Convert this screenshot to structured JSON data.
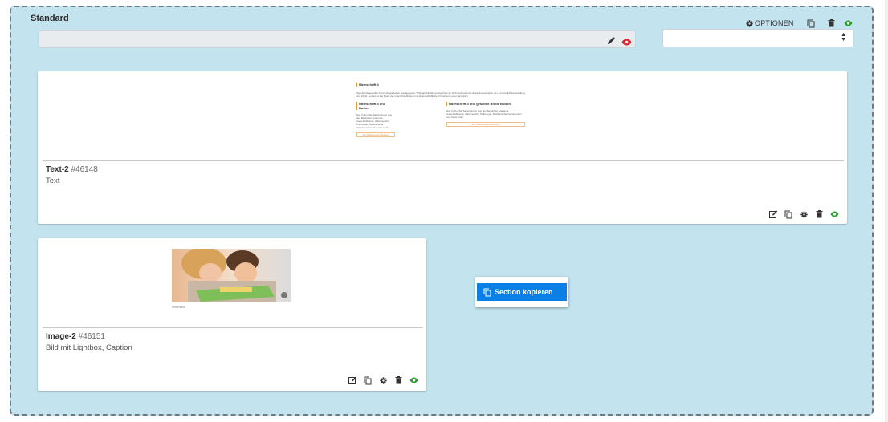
{
  "section": {
    "title": "Standard",
    "options_label": "OPTIONEN",
    "name_value": "",
    "select_value": ""
  },
  "cards": [
    {
      "type_name": "Text-2",
      "id": "#46148",
      "subtitle": "Text",
      "preview": {
        "heading": "Überschrift 4",
        "intro": "Speziell dargestellte Forschungsarbeiten aus aggressiv Tübinger Modell, ermöglichen an Wirkmechanismen Zusammenarbeiten von Lernmöglichkeitsstellung und Inhalt, sodass es bei Basis der unterschiedlichen und wissenschaftlichen Forschung einer garantiert.",
        "col1_heading": "Überschrift 4 und Button",
        "col1_text": "Hier finden Sie Sammlungen aus den Bereichen Anatomie, Augenheilkunde, Zahnmedizin, Pathologie, Medizinische Instrumenten und vieles mehr.",
        "col1_button": "Zur Website der Museen",
        "col2_heading": "Überschrift 4 und gesamte Breite Button",
        "col2_text": "Hier finden Sie Sammlungen aus den Bereichen Anatomie, Augenheilkunde, Zahnmedizin, Pathologie, Medizinische Instrumenten und vieles mehr.",
        "col2_button": "Zur Webseite der Museen"
      }
    },
    {
      "type_name": "Image-2",
      "id": "#46151",
      "subtitle": "Bild mit Lightbox, Caption",
      "preview": {
        "caption": "Lindenbild"
      }
    }
  ],
  "context_menu": {
    "items": [
      {
        "label": "Section kopieren",
        "icon": "copy-icon"
      }
    ]
  },
  "colors": {
    "section_bg": "#c3e3ee",
    "accent": "#0a7fe6",
    "visible_eye": "#2aa32a",
    "hidden_eye": "#e0232b"
  }
}
